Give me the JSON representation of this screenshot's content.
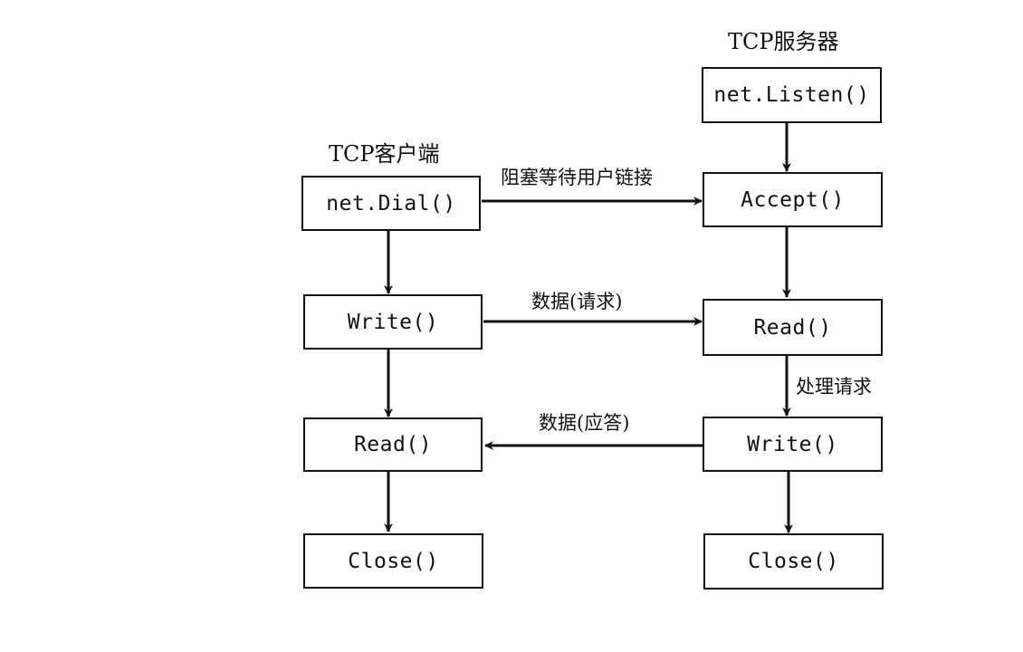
{
  "client": {
    "heading": "TCP客户端",
    "dial": "net.Dial()",
    "write": "Write()",
    "read": "Read()",
    "close": "Close()"
  },
  "server": {
    "heading": "TCP服务器",
    "listen": "net.Listen()",
    "accept": "Accept()",
    "read": "Read()",
    "write": "Write()",
    "close": "Close()"
  },
  "edges": {
    "dial_to_accept": "阻塞等待用户链接",
    "request": "数据(请求)",
    "process": "处理请求",
    "response": "数据(应答)"
  },
  "colors": {
    "stroke": "#111111",
    "background": "#ffffff"
  }
}
